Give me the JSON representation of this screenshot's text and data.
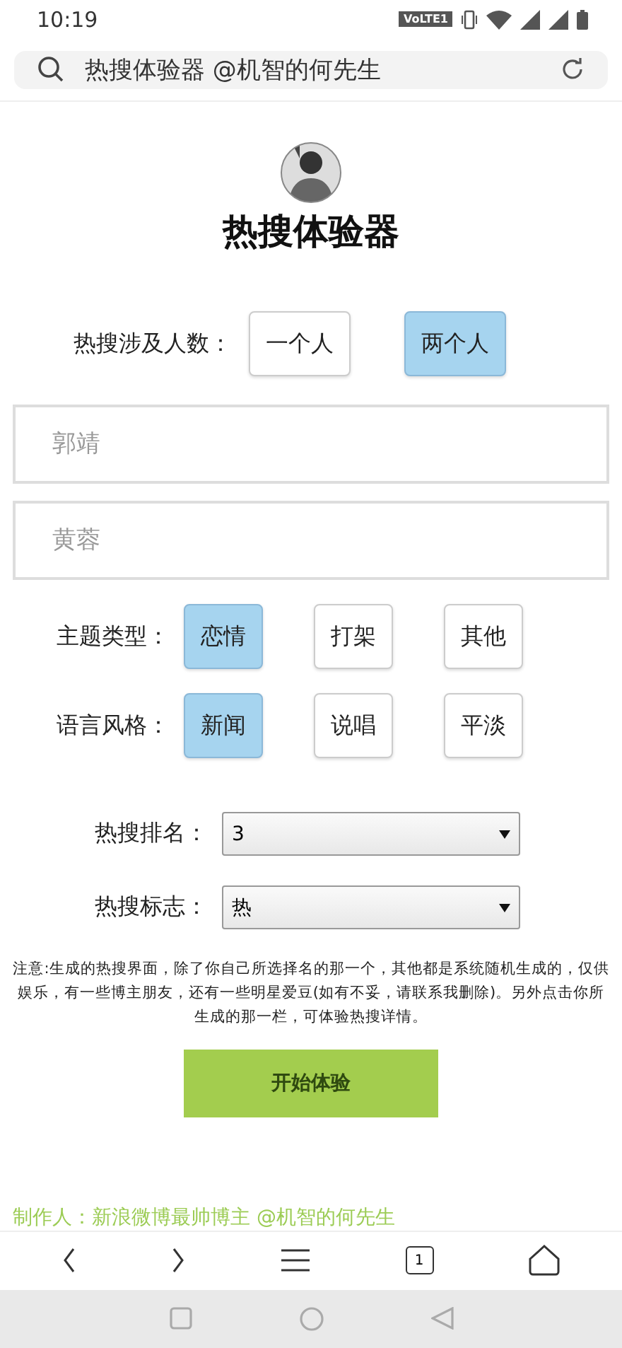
{
  "status_bar": {
    "time": "10:19",
    "network_badge": "VoLTE1"
  },
  "address_bar": {
    "value": "热搜体验器 @机智的何先生"
  },
  "title": "热搜体验器",
  "people_count": {
    "label": "热搜涉及人数：",
    "options": [
      {
        "label": "一个人",
        "selected": false
      },
      {
        "label": "两个人",
        "selected": true
      }
    ]
  },
  "name_fields": [
    {
      "placeholder": "郭靖"
    },
    {
      "placeholder": "黄蓉"
    }
  ],
  "theme": {
    "label": "主题类型：",
    "options": [
      {
        "label": "恋情",
        "selected": true
      },
      {
        "label": "打架",
        "selected": false
      },
      {
        "label": "其他",
        "selected": false
      }
    ]
  },
  "style": {
    "label": "语言风格：",
    "options": [
      {
        "label": "新闻",
        "selected": true
      },
      {
        "label": "说唱",
        "selected": false
      },
      {
        "label": "平淡",
        "selected": false
      }
    ]
  },
  "selects": [
    {
      "label": "热搜排名：",
      "value": "3"
    },
    {
      "label": "热搜标志：",
      "value": "热"
    }
  ],
  "note": "注意:生成的热搜界面，除了你自己所选择名的那一个，其他都是系统随机生成的，仅供娱乐，有一些博主朋友，还有一些明星爱豆(如有不妥，请联系我删除)。另外点击你所生成的那一栏，可体验热搜详情。",
  "start_button": "开始体验",
  "credit": "制作人：新浪微博最帅博主 @机智的何先生",
  "browser_nav": {
    "tab_count": "1"
  }
}
